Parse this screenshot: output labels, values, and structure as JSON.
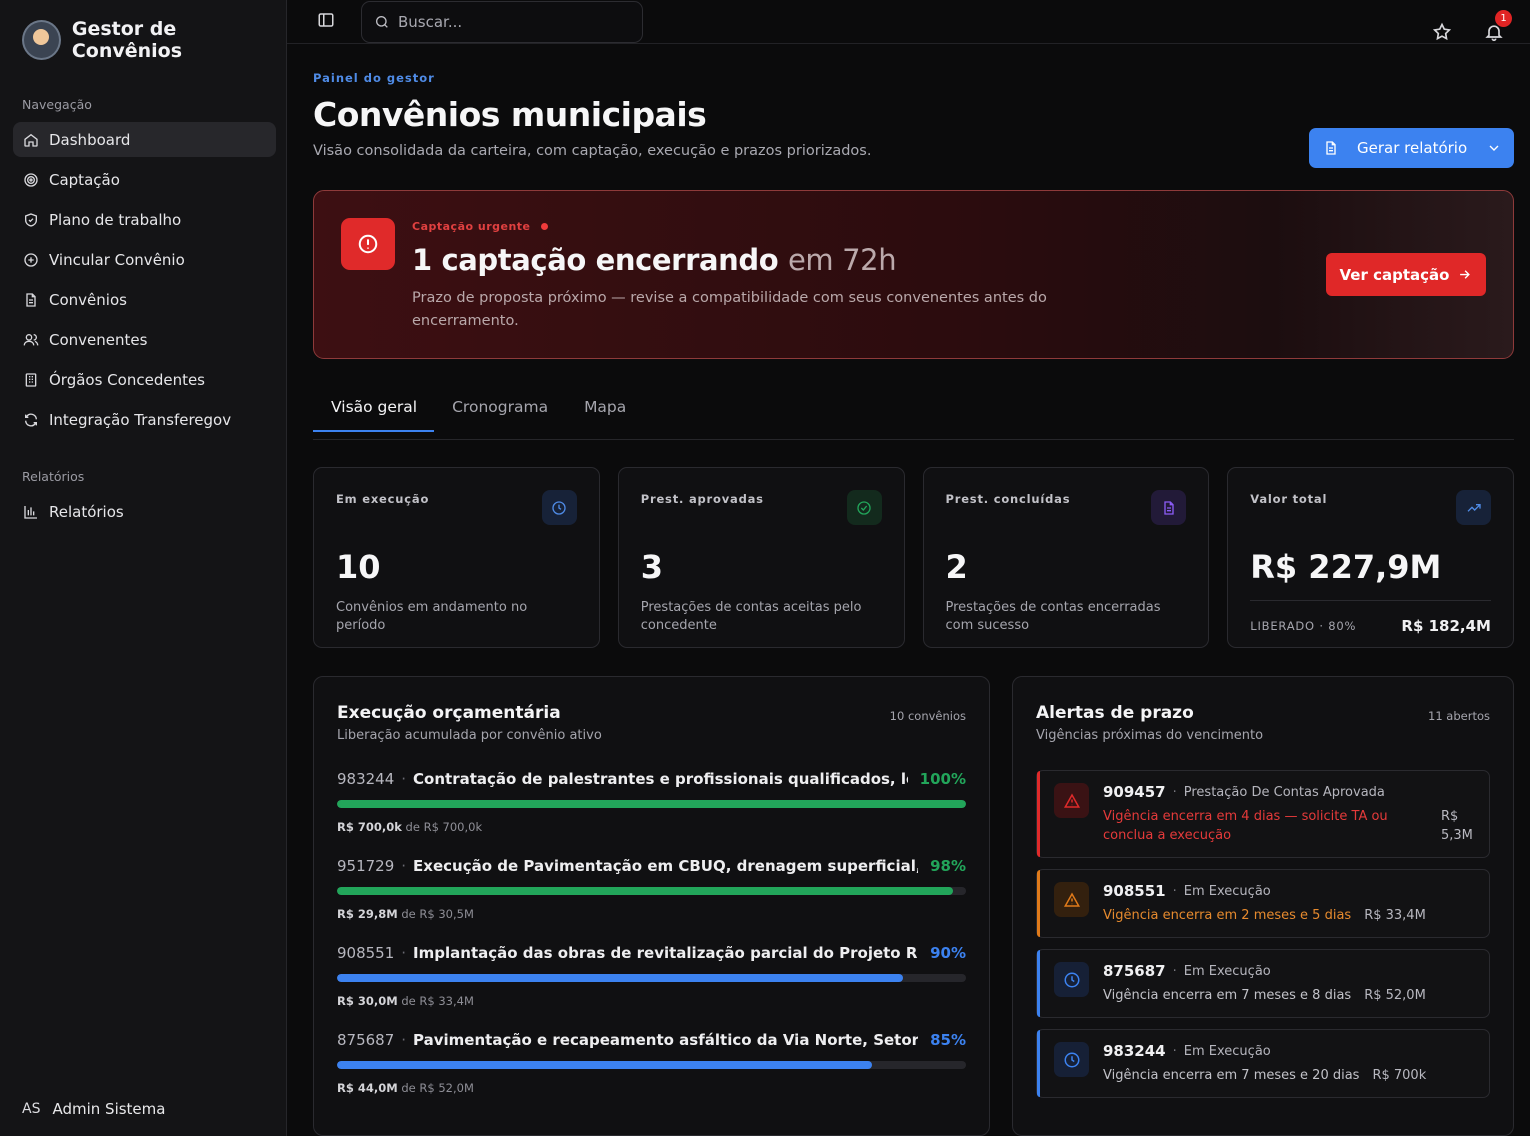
{
  "sidebar": {
    "brand": "Gestor de Convênios",
    "nav_label": "Navegação",
    "items": [
      {
        "label": "Dashboard",
        "icon": "home-icon"
      },
      {
        "label": "Captação",
        "icon": "target-icon"
      },
      {
        "label": "Plano de trabalho",
        "icon": "shield-icon"
      },
      {
        "label": "Vincular Convênio",
        "icon": "plus-circle-icon"
      },
      {
        "label": "Convênios",
        "icon": "file-icon"
      },
      {
        "label": "Convenentes",
        "icon": "users-icon"
      },
      {
        "label": "Órgãos Concedentes",
        "icon": "building-icon"
      },
      {
        "label": "Integração Transferegov",
        "icon": "refresh-icon"
      }
    ],
    "reports_label": "Relatórios",
    "reports_items": [
      {
        "label": "Relatórios",
        "icon": "bar-chart-icon"
      }
    ],
    "user_initials": "AS",
    "user_name": "Admin Sistema"
  },
  "topbar": {
    "search_placeholder": "Buscar...",
    "notifications_count": "1"
  },
  "header": {
    "eyebrow": "Painel do gestor",
    "title": "Convênios municipais",
    "subtitle": "Visão consolidada da carteira, com captação, execução e prazos priorizados.",
    "report_button": "Gerar relatório"
  },
  "urgent": {
    "eyebrow": "Captação urgente",
    "title_main": "1 captação encerrando",
    "title_muted": "em 72h",
    "description": "Prazo de proposta próximo — revise a compatibilidade com seus convenentes antes do encerramento.",
    "button": "Ver captação"
  },
  "tabs": [
    "Visão geral",
    "Cronograma",
    "Mapa"
  ],
  "stats": [
    {
      "label": "Em execução",
      "value": "10",
      "desc": "Convênios em andamento no período",
      "icon": "clock-icon",
      "color": "#4f8be6"
    },
    {
      "label": "Prest. aprovadas",
      "value": "3",
      "desc": "Prestações de contas aceitas pelo concedente",
      "icon": "check-circle-icon",
      "color": "#22a55a"
    },
    {
      "label": "Prest. concluídas",
      "value": "2",
      "desc": "Prestações de contas encerradas com sucesso",
      "icon": "file-text-icon",
      "color": "#8b5cf6"
    },
    {
      "label": "Valor total",
      "value": "R$ 227,9M",
      "foot_label": "LIBERADO · 80%",
      "foot_value": "R$ 182,4M",
      "icon": "trending-up-icon",
      "color": "#4f8be6"
    }
  ],
  "execution": {
    "title": "Execução orçamentária",
    "subtitle": "Liberação acumulada por convênio ativo",
    "count": "10 convênios",
    "rows": [
      {
        "code": "983244",
        "name": "Contratação de palestrantes e profissionais qualificados, lo...",
        "pct_label": "100%",
        "pct": 100,
        "released": "R$ 700,0k",
        "of": "de",
        "total": "R$ 700,0k",
        "color": "#22a55a"
      },
      {
        "code": "951729",
        "name": "Execução de Pavimentação em CBUQ, drenagem superficial, sin...",
        "pct_label": "98%",
        "pct": 98,
        "released": "R$ 29,8M",
        "of": "de",
        "total": "R$ 30,5M",
        "color": "#22a55a"
      },
      {
        "code": "908551",
        "name": "Implantação das obras de revitalização parcial do Projeto Ri...",
        "pct_label": "90%",
        "pct": 90,
        "released": "R$ 30,0M",
        "of": "de",
        "total": "R$ 33,4M",
        "color": "#3c82f0"
      },
      {
        "code": "875687",
        "name": "Pavimentação e recapeamento asfáltico da Via Norte, Setor Ur...",
        "pct_label": "85%",
        "pct": 85,
        "released": "R$ 44,0M",
        "of": "de",
        "total": "R$ 52,0M",
        "color": "#3c82f0"
      }
    ]
  },
  "deadlines": {
    "title": "Alertas de prazo",
    "subtitle": "Vigências próximas do vencimento",
    "count": "11 abertos",
    "items": [
      {
        "code": "909457",
        "status": "Prestação De Contas Aprovada",
        "message": "Vigência encerra em 4 dias — solicite TA ou conclua a execução",
        "value": "R$ 5,3M",
        "level": "critical",
        "icon": "alert-triangle-icon",
        "color": "#e02a2a",
        "msg_color": "#e53a3a"
      },
      {
        "code": "908551",
        "status": "Em Execução",
        "message": "Vigência encerra em 2 meses e 5 dias",
        "value": "R$ 33,4M",
        "level": "warning",
        "icon": "alert-triangle-icon",
        "color": "#e07a1a",
        "msg_color": "#e68a2e"
      },
      {
        "code": "875687",
        "status": "Em Execução",
        "message": "Vigência encerra em 7 meses e 8 dias",
        "value": "R$ 52,0M",
        "level": "info",
        "icon": "clock-icon",
        "color": "#3c82f0",
        "msg_color": "#c2c2c8"
      },
      {
        "code": "983244",
        "status": "Em Execução",
        "message": "Vigência encerra em 7 meses e 20 dias",
        "value": "R$ 700k",
        "level": "info",
        "icon": "clock-icon",
        "color": "#3c82f0",
        "msg_color": "#c2c2c8"
      }
    ]
  }
}
